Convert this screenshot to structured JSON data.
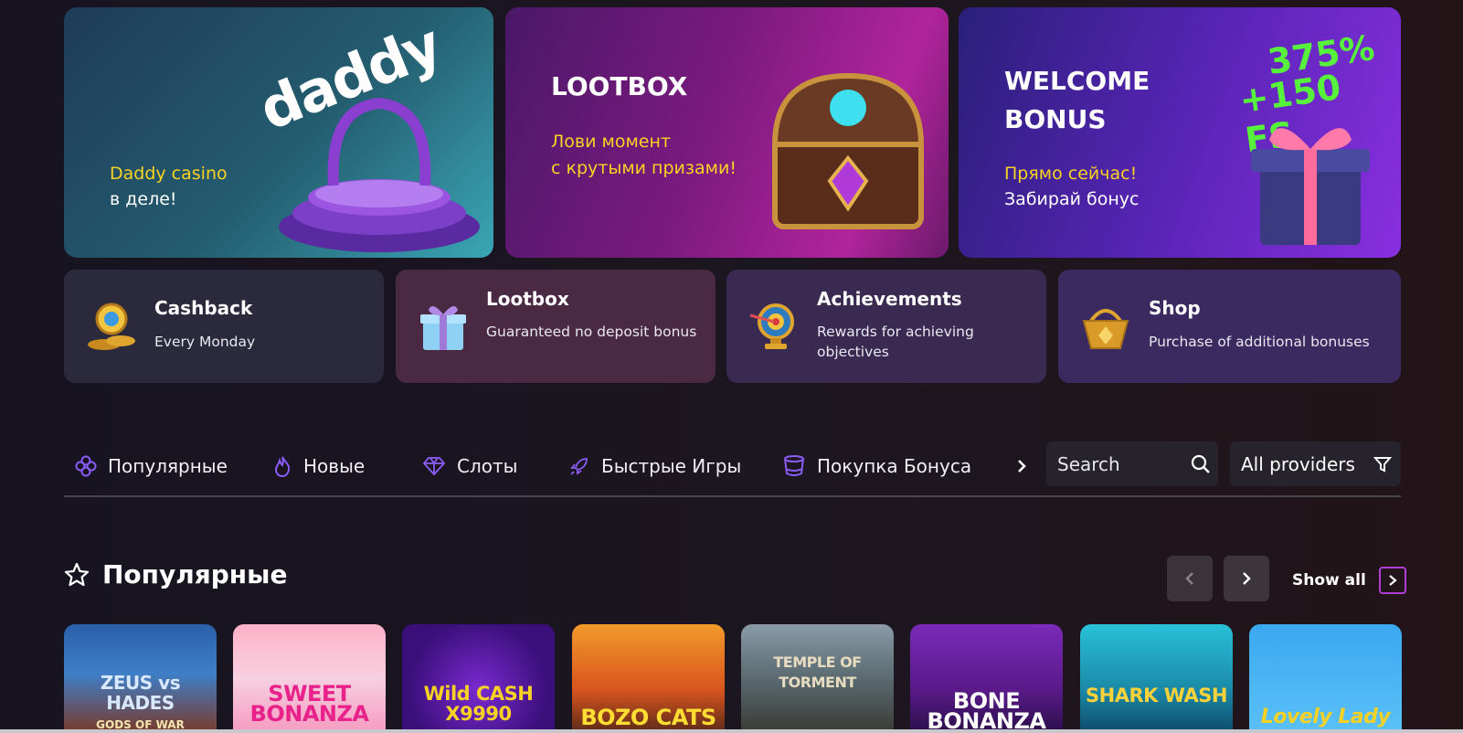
{
  "banners": [
    {
      "title_line1": "",
      "logo": "daddy",
      "sub_yellow": "Daddy casino",
      "sub_white": "в деле!"
    },
    {
      "title_line1": "LOOTBOX",
      "sub_yellow": "Лови момент",
      "sub_yellow2": "с крутыми призами!"
    },
    {
      "title_line1": "WELCOME",
      "title_line2": "BONUS",
      "sub_yellow": "Прямо сейчас!",
      "sub_white": "Забирай бонус",
      "promo_line1": "375%",
      "promo_line2": "+150 FS"
    }
  ],
  "cards": [
    {
      "title": "Cashback",
      "sub": "Every Monday",
      "icon": "coin-stack-icon"
    },
    {
      "title": "Lootbox",
      "sub": "Guaranteed no deposit bonus",
      "icon": "gift-box-icon"
    },
    {
      "title": "Achievements",
      "sub": "Rewards for achieving objectives",
      "icon": "target-trophy-icon"
    },
    {
      "title": "Shop",
      "sub": "Purchase of additional bonuses",
      "icon": "gold-basket-icon"
    }
  ],
  "tabs": [
    {
      "label": "Популярные",
      "icon": "clover-icon"
    },
    {
      "label": "Новые",
      "icon": "flame-icon"
    },
    {
      "label": "Слоты",
      "icon": "diamond-icon"
    },
    {
      "label": "Быстрые Игры",
      "icon": "rocket-icon"
    },
    {
      "label": "Покупка Бонуса",
      "icon": "bucket-icon"
    }
  ],
  "search": {
    "placeholder": "Search"
  },
  "providers": {
    "label": "All providers"
  },
  "section": {
    "title": "Популярные",
    "show_all": "Show all"
  },
  "games": [
    {
      "title": "ZEUS vs HADES",
      "sub": "GODS OF WAR"
    },
    {
      "title": "SWEET BONANZA",
      "sub": ""
    },
    {
      "title": "Wild CASH X9990",
      "sub": ""
    },
    {
      "title": "BOZO CATS",
      "sub": ""
    },
    {
      "title": "TEMPLE OF TORMENT",
      "sub": ""
    },
    {
      "title": "BONE BONANZA",
      "sub": ""
    },
    {
      "title": "SHARK WASH",
      "sub": ""
    },
    {
      "title": "Lovely Lady",
      "sub": ""
    }
  ],
  "colors": {
    "accent_yellow": "#f7d224",
    "accent_purple": "#8a5cf6",
    "showall_border": "#b03dd6"
  }
}
